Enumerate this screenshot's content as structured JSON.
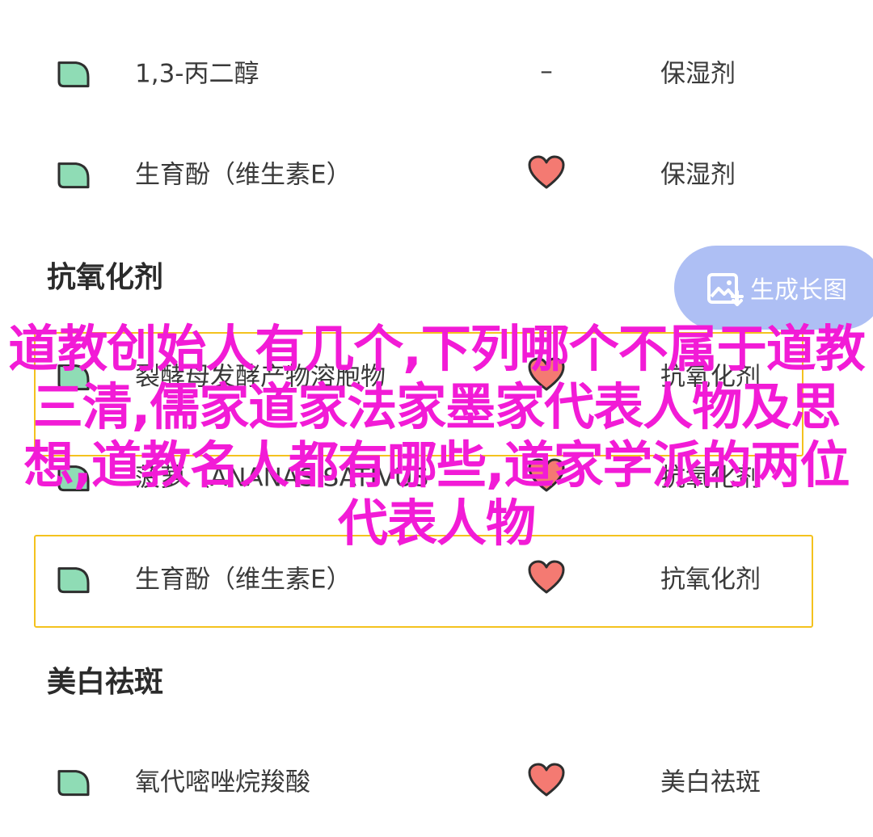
{
  "rows": [
    {
      "name": "1,3-丙二醇",
      "mid": "–",
      "func": "保湿剂",
      "icon": "leaf-icon"
    },
    {
      "name": "生育酚（维生素E）",
      "mid": "",
      "func": "保湿剂",
      "icon": "leaf-icon",
      "mid_icon": "heart-icon"
    },
    {
      "name": "裂酵母发酵产物溶胞物",
      "mid": "",
      "func": "抗氧化剂",
      "icon": "leaf-icon",
      "mid_icon": "heart-icon"
    },
    {
      "name": "菠萝（ANANAS SATIVUS",
      "mid": "",
      "func": "抗氧化剂",
      "icon": "leaf-icon",
      "mid_icon": "heart-icon"
    },
    {
      "name": "生育酚（维生素E）",
      "mid": "",
      "func": "抗氧化剂",
      "icon": "leaf-icon",
      "mid_icon": "heart-icon"
    },
    {
      "name": "氧代嘧唑烷羧酸",
      "mid": "",
      "func": "美白祛斑",
      "icon": "leaf-icon",
      "mid_icon": "heart-icon"
    }
  ],
  "sections": {
    "antioxidant": "抗氧化剂",
    "whitening": "美白祛斑"
  },
  "generate_button": {
    "label": "生成长图",
    "icon": "image-icon"
  },
  "overlay_title": "道教创始人有几个,下列哪个不属于道教三清,儒家道家法家墨家代表人物及思想,道教名人都有哪些,道家学派的两位代表人物",
  "colors": {
    "leaf": "#8fdcb5",
    "heart": "#f47a72",
    "highlight_border": "#f4c21e",
    "overlay_text": "#f21bd6",
    "button_bg": "#aebff4"
  }
}
